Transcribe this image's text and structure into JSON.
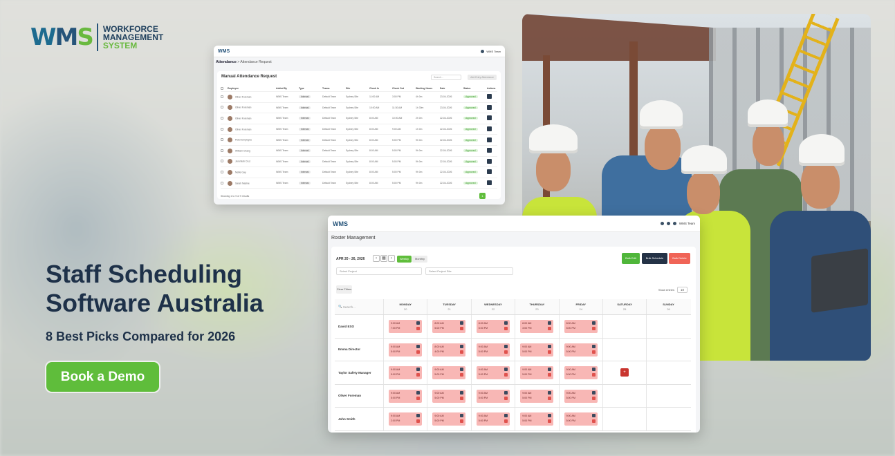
{
  "brand": {
    "logo_letters": [
      "W",
      "M",
      "S"
    ],
    "line1": "WORKFORCE",
    "line2": "MANAGEMENT",
    "line3": "SYSTEM",
    "colors": {
      "blue": "#26547a",
      "green": "#69b93f"
    }
  },
  "hero": {
    "title": "Staff Scheduling Software Australia",
    "subtitle": "8 Best Picks Compared for 2026",
    "cta": "Book a Demo",
    "cta_color": "#5fbd3b"
  },
  "attendance": {
    "logo": "WMS",
    "user": "WMS Team",
    "breadcrumb_main": "Attendance",
    "breadcrumb_sub": "> Attendance Request",
    "card_title": "Manual Attendance Request",
    "search_placeholder": "Search...",
    "button": "Add Entry Attendance",
    "columns": [
      "Employee",
      "Added By",
      "Type",
      "Teams",
      "Site",
      "Check In",
      "Check Out",
      "Working Hours",
      "Date",
      "Status",
      "Actions"
    ],
    "rows": [
      {
        "name": "Oliver Foreman",
        "by": "WMS Team",
        "type": "Internal",
        "team": "Default Team",
        "site": "Sydney Site",
        "in": "11:00 AM",
        "out": "3:00 PM",
        "hrs": "4h 0m",
        "date": "23-04-2026",
        "status": "Approved"
      },
      {
        "name": "Oliver Foreman",
        "by": "WMS Team",
        "type": "Internal",
        "team": "Default Team",
        "site": "Sydney Site",
        "in": "10:00 AM",
        "out": "11:30 AM",
        "hrs": "1h 30m",
        "date": "23-04-2026",
        "status": "Approved"
      },
      {
        "name": "Oliver Foreman",
        "by": "WMS Team",
        "type": "Internal",
        "team": "Default Team",
        "site": "Sydney Site",
        "in": "8:00 AM",
        "out": "10:00 AM",
        "hrs": "2h 0m",
        "date": "22-04-2026",
        "status": "Approved"
      },
      {
        "name": "Oliver Foreman",
        "by": "WMS Team",
        "type": "Internal",
        "team": "Default Team",
        "site": "Sydney Site",
        "in": "8:00 AM",
        "out": "9:00 AM",
        "hrs": "1h 0m",
        "date": "22-04-2026",
        "status": "Approved"
      },
      {
        "name": "Peter Employee",
        "by": "WMS Team",
        "type": "Internal",
        "team": "Default Team",
        "site": "Sydney Site",
        "in": "8:00 AM",
        "out": "5:00 PM",
        "hrs": "9h 0m",
        "date": "22-04-2026",
        "status": "Approved"
      },
      {
        "name": "William Chang",
        "by": "WMS Team",
        "type": "Internal",
        "team": "Default Team",
        "site": "Sydney Site",
        "in": "8:00 AM",
        "out": "5:00 PM",
        "hrs": "9h 0m",
        "date": "22-04-2026",
        "status": "Approved"
      },
      {
        "name": "Jeremiah Cruz",
        "by": "WMS Team",
        "type": "Internal",
        "team": "Default Team",
        "site": "Sydney Site",
        "in": "8:00 AM",
        "out": "5:00 PM",
        "hrs": "9h 0m",
        "date": "22-04-2026",
        "status": "Approved"
      },
      {
        "name": "Nellie Gay",
        "by": "WMS Team",
        "type": "Internal",
        "team": "Default Team",
        "site": "Sydney Site",
        "in": "8:00 AM",
        "out": "5:00 PM",
        "hrs": "9h 0m",
        "date": "22-04-2026",
        "status": "Approved"
      },
      {
        "name": "Sarah Nadine",
        "by": "WMS Team",
        "type": "Internal",
        "team": "Default Team",
        "site": "Sydney Site",
        "in": "8:00 AM",
        "out": "5:00 PM",
        "hrs": "9h 0m",
        "date": "22-04-2026",
        "status": "Approved"
      }
    ],
    "footer": "Showing 1 to 9 of 9 results",
    "page": "1"
  },
  "roster": {
    "logo": "WMS",
    "user": "WMS Team",
    "title": "Roster Management",
    "date_range": "APR 20 - 26, 2026",
    "prev": "‹",
    "next": "›",
    "cal": "▦",
    "view_weekly": "Weekly",
    "view_monthly": "Monthly",
    "bulk_edit": "Bulk Edit",
    "bulk_schedule": "Bulk Schedule",
    "bulk_delete": "Bulk Delete",
    "select_project": "Select Project",
    "select_project_site": "Select Project Site",
    "clear": "Clear Filters",
    "show_entries": "Show entries",
    "entries_value": "10",
    "search_placeholder": "Search...",
    "days": [
      {
        "name": "MONDAY",
        "num": "20"
      },
      {
        "name": "TUESDAY",
        "num": "21"
      },
      {
        "name": "WEDNESDAY",
        "num": "22"
      },
      {
        "name": "THURSDAY",
        "num": "23"
      },
      {
        "name": "FRIDAY",
        "num": "24"
      },
      {
        "name": "SATURDAY",
        "num": "25"
      },
      {
        "name": "SUNDAY",
        "num": "26"
      }
    ],
    "employees": [
      {
        "name": "David ESO",
        "shifts": [
          [
            "9:00 AM",
            "7:00 PM"
          ],
          [
            "8:00 AM",
            "5:00 PM"
          ],
          [
            "8:00 AM",
            "5:00 PM"
          ],
          [
            "8:00 AM",
            "3:00 PM"
          ],
          [
            "8:00 AM",
            "5:00 PM"
          ]
        ]
      },
      {
        "name": "Emma Director",
        "shifts": [
          [
            "9:00 AM",
            "5:00 PM"
          ],
          [
            "8:00 AM",
            "4:00 PM"
          ],
          [
            "9:00 AM",
            "5:00 PM"
          ],
          [
            "9:00 AM",
            "5:00 PM"
          ],
          [
            "9:00 AM",
            "5:00 PM"
          ]
        ]
      },
      {
        "name": "Taylor Safety Manager",
        "shifts": [
          [
            "9:00 AM",
            "5:00 PM"
          ],
          [
            "9:00 AM",
            "5:00 PM"
          ],
          [
            "9:00 AM",
            "5:00 PM"
          ],
          [
            "9:00 AM",
            "5:00 PM"
          ],
          [
            "9:00 AM",
            "5:00 PM"
          ]
        ],
        "add": "+"
      },
      {
        "name": "Oliver Foreman",
        "shifts": [
          [
            "9:00 AM",
            "5:00 PM"
          ],
          [
            "9:00 AM",
            "5:00 PM"
          ],
          [
            "9:00 AM",
            "5:00 PM"
          ],
          [
            "9:00 AM",
            "5:00 PM"
          ],
          [
            "9:00 AM",
            "5:00 PM"
          ]
        ]
      },
      {
        "name": "John Smith",
        "shifts": [
          [
            "9:00 AM",
            "2:00 PM"
          ],
          [
            "9:00 AM",
            "5:00 PM"
          ],
          [
            "9:00 AM",
            "5:00 PM"
          ],
          [
            "9:00 AM",
            "5:00 PM"
          ],
          [
            "9:00 AM",
            "5:00 PM"
          ]
        ]
      }
    ]
  }
}
